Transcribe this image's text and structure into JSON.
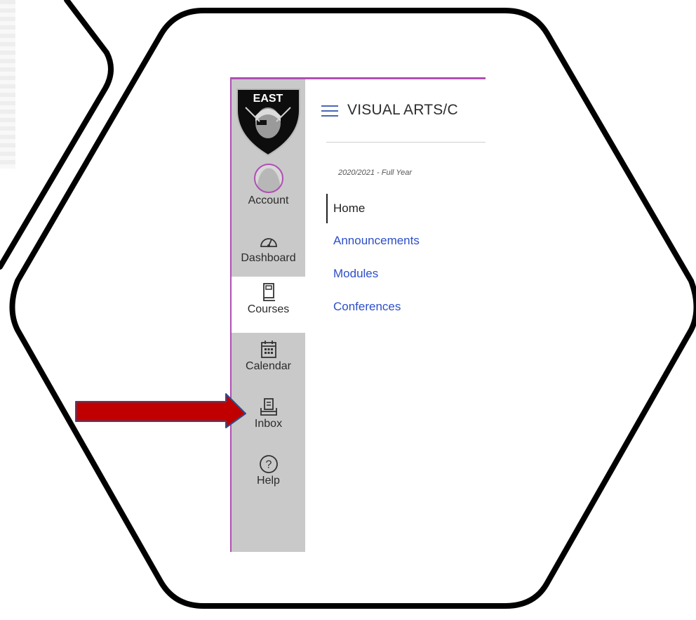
{
  "nav": {
    "logo_text": "EAST",
    "items": [
      {
        "label": "Account",
        "icon": "avatar"
      },
      {
        "label": "Dashboard",
        "icon": "dashboard-gauge-icon"
      },
      {
        "label": "Courses",
        "icon": "courses-book-icon",
        "active": true
      },
      {
        "label": "Calendar",
        "icon": "calendar-icon"
      },
      {
        "label": "Inbox",
        "icon": "inbox-icon"
      },
      {
        "label": "Help",
        "icon": "help-icon"
      }
    ]
  },
  "header": {
    "course_title": "VISUAL ARTS/C"
  },
  "course": {
    "term": "2020/2021 - Full Year",
    "menu": [
      "Home",
      "Announcements",
      "Modules",
      "Conferences"
    ]
  },
  "colors": {
    "accent": "#b04fb3",
    "link": "#2d4ec9",
    "arrow": "#c00000",
    "nav_bg": "#c9c9c9"
  }
}
